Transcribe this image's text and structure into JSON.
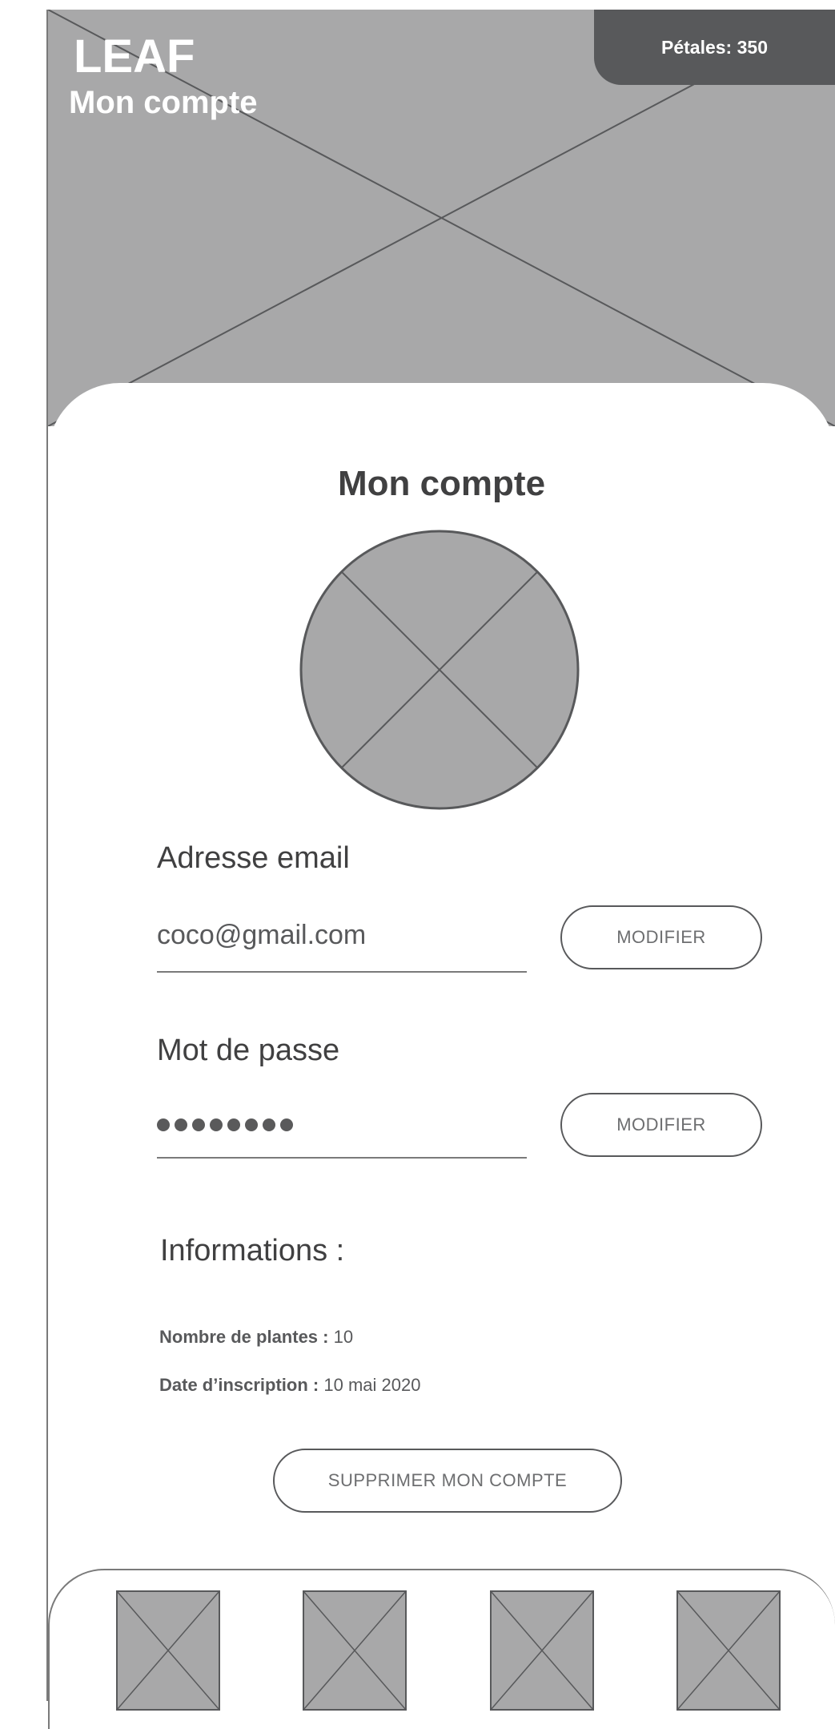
{
  "header": {
    "app_name": "LEAF",
    "page_subtitle": "Mon compte",
    "petals_label": "Pétales: 350"
  },
  "account": {
    "title": "Mon compte",
    "email_label": "Adresse email",
    "email_value": "coco@gmail.com",
    "email_modify": "MODIFIER",
    "password_label": "Mot de passe",
    "password_dot_count": 8,
    "password_modify": "MODIFIER",
    "info_heading": "Informations :",
    "plants_label": "Nombre de plantes :",
    "plants_value": "10",
    "signup_label": "Date d’inscription :",
    "signup_value": "10 mai 2020",
    "delete_button": "SUPPRIMER MON COMPTE"
  },
  "bottom_nav": {
    "items": [
      "nav-item-1",
      "nav-item-2",
      "nav-item-3",
      "nav-item-4"
    ]
  },
  "colors": {
    "placeholder_gray": "#a8a8a9",
    "badge_dark": "#58595b",
    "text_dark": "#404041"
  }
}
